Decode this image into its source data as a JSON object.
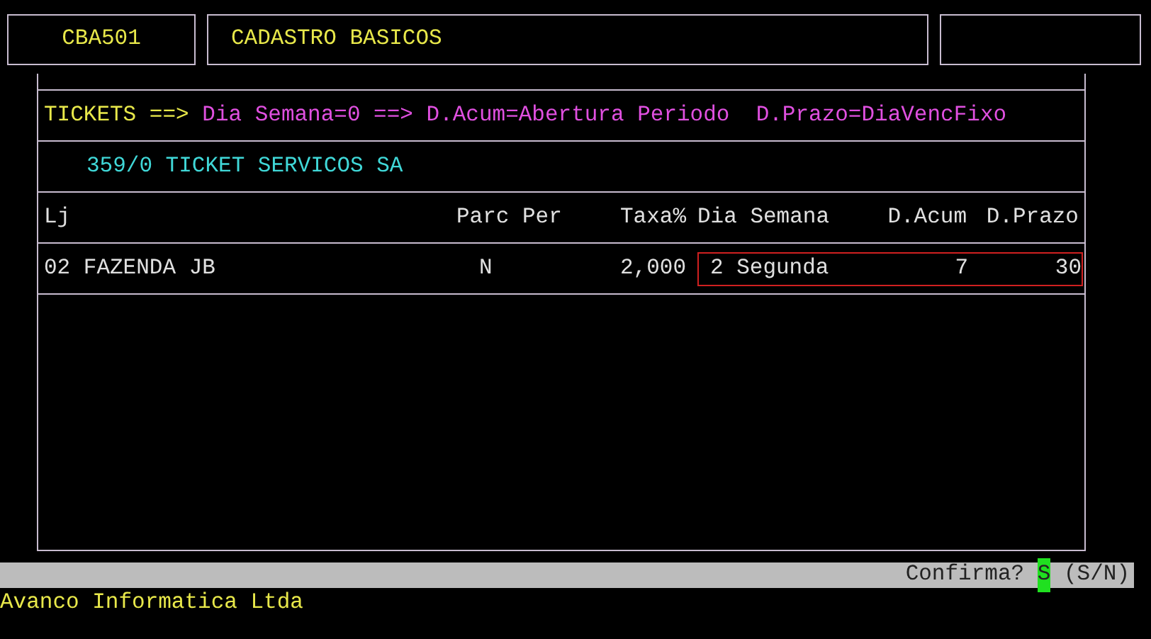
{
  "header": {
    "program_code": "CBA501",
    "title": "CADASTRO BASICOS"
  },
  "legend": [
    {
      "text": "TICKETS ==>",
      "color": "#e8e84a"
    },
    {
      "text": "Dia Semana=0 ==> D.Acum=Abertura Periodo",
      "color": "#e050e0"
    },
    {
      "text": "D.Prazo=DiaVencFixo",
      "color": "#e050e0"
    }
  ],
  "company": "359/0 TICKET SERVICOS SA",
  "table": {
    "columns": [
      "Lj",
      "Parc Per",
      "Taxa%",
      "Dia Semana",
      "D.Acum",
      "D.Prazo"
    ],
    "rows": [
      {
        "cells": [
          "02 FAZENDA JB",
          "N",
          "2,000",
          "2 Segunda",
          "7",
          "30"
        ],
        "selected": true
      }
    ]
  },
  "status_bar": {
    "prompt": "Confirma?",
    "answer": "S",
    "options": "(S/N)"
  },
  "footer": "Avanco Informatica Ltda"
}
